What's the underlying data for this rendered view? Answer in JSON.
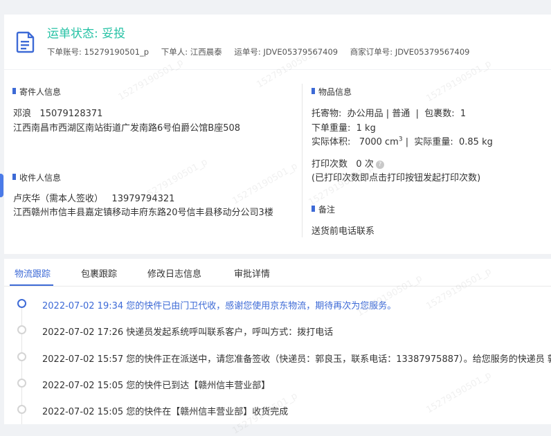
{
  "header": {
    "status": "运单状态: 妥投",
    "account_label": "下单账号:",
    "account": "15279190501_p",
    "orderer_label": "下单人:",
    "orderer": "江西晨泰",
    "waybill_label": "运单号:",
    "waybill": "JDVE05379567409",
    "merchant_order_label": "商家订单号:",
    "merchant_order": "JDVE05379567409"
  },
  "sender": {
    "title": "寄件人信息",
    "name": "邓浪",
    "phone": "15079128371",
    "address": "江西南昌市西湖区南站街道广发南路6号伯爵公馆B座508"
  },
  "receiver": {
    "title": "收件人信息",
    "name": "卢庆华（需本人签收）",
    "phone": "13979794321",
    "address": "江西赣州市信丰县嘉定镇移动丰府东路20号信丰县移动分公司3楼"
  },
  "goods": {
    "title": "物品信息",
    "item_label": "托寄物:",
    "item": "办公用品 | 普通",
    "packages_label": "包裹数:",
    "packages": "1",
    "order_weight_label": "下单重量:",
    "order_weight": "1 kg",
    "volume_label": "实际体积:",
    "volume": "7000 cm",
    "volume_sup": "3",
    "actual_weight_label": "实际重量:",
    "actual_weight": "0.85 kg",
    "print_label": "打印次数",
    "print_count": "0 次",
    "print_note": "(已打印次数即点击打印按钮发起打印次数)"
  },
  "remark": {
    "title": "备注",
    "text": "送货前电话联系"
  },
  "tabs": [
    "物流跟踪",
    "包裹跟踪",
    "修改日志信息",
    "审批详情"
  ],
  "timeline": [
    "2022-07-02 19:34 您的快件已由门卫代收，感谢您使用京东物流，期待再次为您服务。",
    "2022-07-02 17:26 快递员发起系统呼叫联系客户，呼叫方式：拨打电话",
    "2022-07-02 15:57 您的快件正在派送中，请您准备签收（快递员：郭良玉，联系电话：13387975887）。给您服务的快递员 郭良玉",
    "2022-07-02 15:05 您的快件已到达【赣州信丰营业部】",
    "2022-07-02 15:05 您的快件在【赣州信丰营业部】收货完成"
  ],
  "watermark": "15279190501_p",
  "colors": {
    "accent": "#3d6ad6",
    "status": "#27c2a5",
    "background": "#f0f2f5"
  },
  "icons": {
    "doc": "document-icon",
    "help": "help-icon"
  }
}
